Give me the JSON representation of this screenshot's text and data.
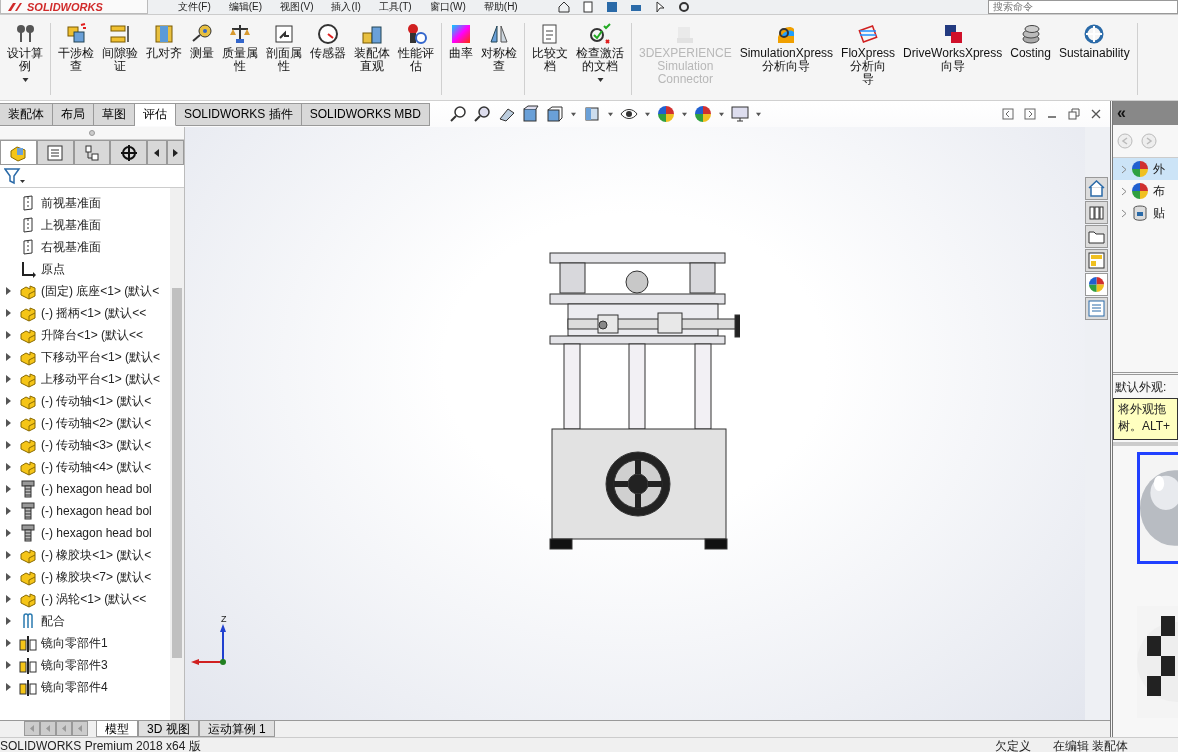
{
  "app": {
    "logo": "SOLIDWORKS"
  },
  "menu": [
    "文件(F)",
    "编辑(E)",
    "视图(V)",
    "插入(I)",
    "工具(T)",
    "窗口(W)",
    "帮助(H)"
  ],
  "search": {
    "placeholder": "搜索命令"
  },
  "ribbon": {
    "groups": [
      {
        "items": [
          {
            "lines": [
              "设计算",
              "例"
            ],
            "dropdown": true,
            "disabled": false
          }
        ]
      },
      {
        "items": [
          {
            "lines": [
              "干涉检",
              "查"
            ],
            "dropdown": false,
            "disabled": false
          },
          {
            "lines": [
              "间隙验",
              "证"
            ],
            "dropdown": false,
            "disabled": false
          },
          {
            "lines": [
              "孔对齐"
            ],
            "dropdown": false,
            "disabled": false
          },
          {
            "lines": [
              "测量"
            ],
            "dropdown": false,
            "disabled": false
          },
          {
            "lines": [
              "质量属",
              "性"
            ],
            "dropdown": false,
            "disabled": false
          },
          {
            "lines": [
              "剖面属",
              "性"
            ],
            "dropdown": false,
            "disabled": false
          },
          {
            "lines": [
              "传感器"
            ],
            "dropdown": false,
            "disabled": false
          },
          {
            "lines": [
              "装配体",
              "直观"
            ],
            "dropdown": false,
            "disabled": false
          },
          {
            "lines": [
              "性能评",
              "估"
            ],
            "dropdown": false,
            "disabled": false
          }
        ]
      },
      {
        "items": [
          {
            "lines": [
              "曲率"
            ],
            "dropdown": false,
            "disabled": false
          },
          {
            "lines": [
              "对称检",
              "查"
            ],
            "dropdown": false,
            "disabled": false
          }
        ]
      },
      {
        "items": [
          {
            "lines": [
              "比较文",
              "档"
            ],
            "dropdown": false,
            "disabled": false
          },
          {
            "lines": [
              "检查激活",
              "的文档"
            ],
            "dropdown": true,
            "disabled": false
          }
        ]
      },
      {
        "items": [
          {
            "lines": [
              "3DEXPERIENCE",
              "Simulation",
              "Connector"
            ],
            "dropdown": false,
            "disabled": true
          },
          {
            "lines": [
              "SimulationXpress",
              "分析向导"
            ],
            "dropdown": false,
            "disabled": false
          },
          {
            "lines": [
              "FloXpress",
              "分析向",
              "导"
            ],
            "dropdown": false,
            "disabled": false
          },
          {
            "lines": [
              "DriveWorksXpress",
              "向导"
            ],
            "dropdown": false,
            "disabled": false
          },
          {
            "lines": [
              "Costing"
            ],
            "dropdown": false,
            "disabled": false
          },
          {
            "lines": [
              "Sustainability"
            ],
            "dropdown": false,
            "disabled": false
          }
        ]
      }
    ]
  },
  "tabs": [
    {
      "label": "装配体",
      "selected": false
    },
    {
      "label": "布局",
      "selected": false
    },
    {
      "label": "草图",
      "selected": false
    },
    {
      "label": "评估",
      "selected": true
    },
    {
      "label": "SOLIDWORKS 插件",
      "selected": false
    },
    {
      "label": "SOLIDWORKS MBD",
      "selected": false
    }
  ],
  "feature_tree": {
    "items": [
      {
        "label": "前视基准面",
        "kind": "plane",
        "expandable": false
      },
      {
        "label": "上视基准面",
        "kind": "plane",
        "expandable": false
      },
      {
        "label": "右视基准面",
        "kind": "plane",
        "expandable": false
      },
      {
        "label": "原点",
        "kind": "origin",
        "expandable": false
      },
      {
        "label": "(固定) 底座<1> (默认<",
        "kind": "part",
        "expandable": true
      },
      {
        "label": "(-) 摇柄<1> (默认<<",
        "kind": "part",
        "expandable": true
      },
      {
        "label": "升降台<1> (默认<<",
        "kind": "part",
        "expandable": true
      },
      {
        "label": "下移动平台<1> (默认<",
        "kind": "part",
        "expandable": true
      },
      {
        "label": "上移动平台<1> (默认<",
        "kind": "part",
        "expandable": true
      },
      {
        "label": "(-) 传动轴<1> (默认<",
        "kind": "part",
        "expandable": true
      },
      {
        "label": "(-) 传动轴<2> (默认<",
        "kind": "part",
        "expandable": true
      },
      {
        "label": "(-) 传动轴<3> (默认<",
        "kind": "part",
        "expandable": true
      },
      {
        "label": "(-) 传动轴<4> (默认<",
        "kind": "part",
        "expandable": true
      },
      {
        "label": "(-) hexagon head bol",
        "kind": "bolt",
        "expandable": true
      },
      {
        "label": "(-) hexagon head bol",
        "kind": "bolt",
        "expandable": true
      },
      {
        "label": "(-) hexagon head bol",
        "kind": "bolt",
        "expandable": true
      },
      {
        "label": "(-) 橡胶块<1> (默认<",
        "kind": "part",
        "expandable": true
      },
      {
        "label": "(-) 橡胶块<7> (默认<",
        "kind": "part",
        "expandable": true
      },
      {
        "label": "(-) 涡轮<1> (默认<<",
        "kind": "part",
        "expandable": true
      },
      {
        "label": "配合",
        "kind": "mates",
        "expandable": true
      },
      {
        "label": "镜向零部件1",
        "kind": "mirror",
        "expandable": true
      },
      {
        "label": "镜向零部件3",
        "kind": "mirror",
        "expandable": true
      },
      {
        "label": "镜向零部件4",
        "kind": "mirror",
        "expandable": true
      }
    ]
  },
  "triad": {
    "z_label": "Z"
  },
  "bottom_tabs": [
    {
      "label": "模型",
      "selected": true
    },
    {
      "label": "3D 视图",
      "selected": false
    },
    {
      "label": "运动算例 1",
      "selected": false
    }
  ],
  "right_panel": {
    "collapse": "«",
    "items": [
      {
        "label": "外",
        "selected": true
      },
      {
        "label": "布",
        "selected": false
      },
      {
        "label": "贴",
        "selected": false
      }
    ],
    "caption": "默认外观:",
    "tooltip_lines": [
      "将外观拖",
      "树。ALT+"
    ]
  },
  "status_bar": {
    "product": "SOLIDWORKS Premium 2018 x64 版",
    "state": "欠定义",
    "mode": "在编辑 装配体"
  }
}
